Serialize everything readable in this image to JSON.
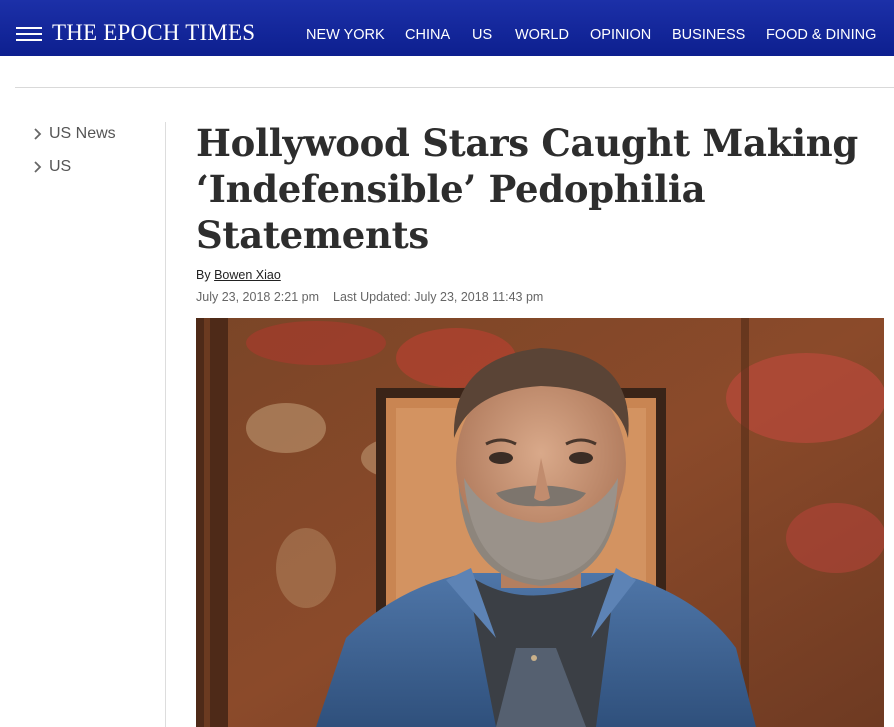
{
  "header": {
    "brand": "THE EPOCH TIMES",
    "nav": [
      "NEW YORK",
      "CHINA",
      "US",
      "WORLD",
      "OPINION",
      "BUSINESS",
      "FOOD & DINING"
    ],
    "menu_icon": "hamburger-menu-icon",
    "background_color": "#13279c"
  },
  "sidebar": {
    "items": [
      {
        "label": "US News",
        "icon": "chevron-right-icon"
      },
      {
        "label": "US",
        "icon": "chevron-right-icon"
      }
    ]
  },
  "article": {
    "headline": "Hollywood Stars Caught Making ‘Indefensible’ Pedophilia Statements",
    "byline_prefix": "By",
    "author": "Bowen Xiao",
    "published": "July 23, 2018 2:21 pm",
    "updated": "Last Updated: July 23, 2018 11:43 pm",
    "image_alt": "Photo of a bearded man in a blue denim shirt standing in front of a weathered red-brown wall"
  }
}
